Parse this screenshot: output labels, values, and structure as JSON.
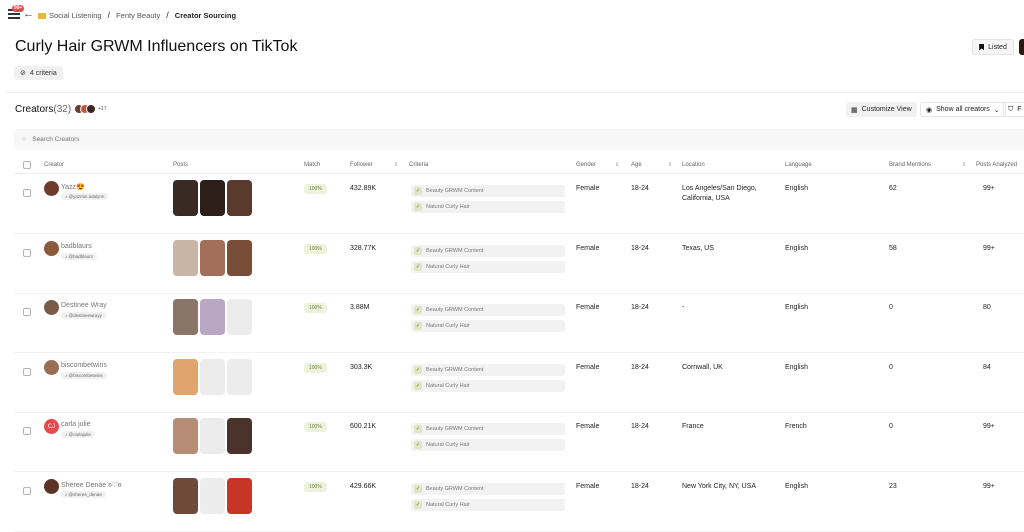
{
  "header": {
    "notification_count": "99+",
    "breadcrumb": [
      "Social Listening",
      "Fenty Beauty",
      "Creator Sourcing"
    ],
    "title": "Curly Hair GRWM Influencers on TikTok",
    "criteria_chip": "4 criteria",
    "listed_label": "Listed"
  },
  "creators": {
    "title": "Creators",
    "count": "(32)",
    "more_avatars": "+17",
    "customize_label": "Customize View",
    "show_all_label": "Show all creators",
    "filter_label": "F",
    "search_placeholder": "Search Creators"
  },
  "columns": {
    "creator": "Creator",
    "posts": "Posts",
    "match": "Match",
    "follower": "Follower",
    "criteria": "Criteria",
    "gender": "Gender",
    "age": "Age",
    "location": "Location",
    "language": "Language",
    "brand_mentions": "Brand Mentions",
    "posts_analyzed": "Posts Analyzed"
  },
  "rows": [
    {
      "name": "Yazz😍",
      "handle": "@yazmin.adalynn",
      "match": "100%",
      "follower": "432.89K",
      "criteria": [
        "Beauty GRWM Content",
        "Natural Curly Hair"
      ],
      "gender": "Female",
      "age": "18-24",
      "location": "Los Angeles/San Diego, California, USA",
      "language": "English",
      "brand_mentions": "62",
      "posts_analyzed": "99+",
      "posts": 3,
      "avatar_color": "#6b3d2a"
    },
    {
      "name": "badblaurs",
      "handle": "@badblaurs",
      "match": "100%",
      "follower": "328.77K",
      "criteria": [
        "Beauty GRWM Content",
        "Natural Curly Hair"
      ],
      "gender": "Female",
      "age": "18-24",
      "location": "Texas, US",
      "language": "English",
      "brand_mentions": "58",
      "posts_analyzed": "99+",
      "posts": 3,
      "avatar_color": "#8a5a3b"
    },
    {
      "name": "Destinee Wray",
      "handle": "@destineewrayy",
      "match": "100%",
      "follower": "3.88M",
      "criteria": [
        "Beauty GRWM Content",
        "Natural Curly Hair"
      ],
      "gender": "Female",
      "age": "18-24",
      "location": "-",
      "language": "English",
      "brand_mentions": "0",
      "posts_analyzed": "80",
      "posts": 2,
      "avatar_color": "#7a5a48"
    },
    {
      "name": "biscombetwins",
      "handle": "@biscombetwins",
      "match": "100%",
      "follower": "303.3K",
      "criteria": [
        "Beauty GRWM Content",
        "Natural Curly Hair"
      ],
      "gender": "Female",
      "age": "18-24",
      "location": "Cornwall, UK",
      "language": "English",
      "brand_mentions": "0",
      "posts_analyzed": "84",
      "posts": 1,
      "avatar_color": "#9a6e55"
    },
    {
      "name": "carla julie",
      "handle": "@carlajulie",
      "match": "100%",
      "follower": "600.21K",
      "criteria": [
        "Beauty GRWM Content",
        "Natural Curly Hair"
      ],
      "gender": "Female",
      "age": "18-24",
      "location": "France",
      "language": "French",
      "brand_mentions": "0",
      "posts_analyzed": "99+",
      "posts": 2,
      "avatar_color": "#e5484d",
      "avatar_initials": "CJ"
    },
    {
      "name": "Sheree Denàe ʚ♡ɞ",
      "handle": "@sheree_denae",
      "match": "100%",
      "follower": "429.66K",
      "criteria": [
        "Beauty GRWM Content",
        "Natural Curly Hair"
      ],
      "gender": "Female",
      "age": "18-24",
      "location": "New York City, NY, USA",
      "language": "English",
      "brand_mentions": "23",
      "posts_analyzed": "99+",
      "posts": 3,
      "avatar_color": "#5a3324"
    }
  ]
}
